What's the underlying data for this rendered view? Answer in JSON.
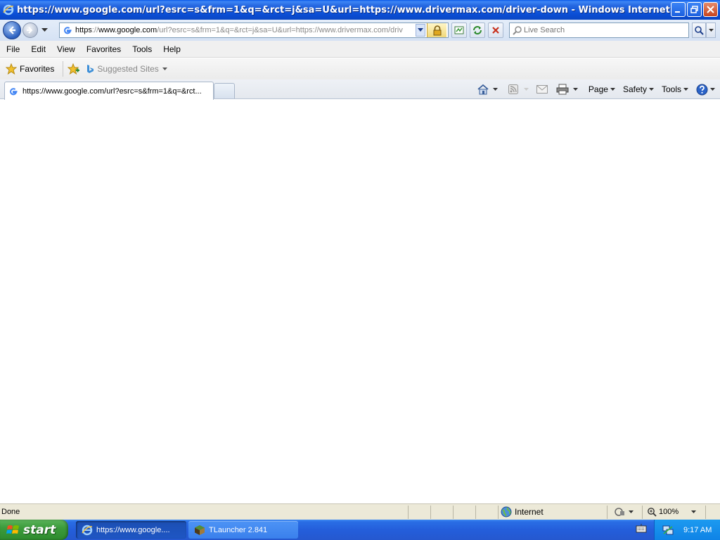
{
  "window": {
    "title": "https://www.google.com/url?esrc=s&frm=1&q=&rct=j&sa=U&url=https://www.drivermax.com/driver-down - Windows Internet Explorer"
  },
  "address": {
    "scheme": "https",
    "rest_prefix": "://",
    "host": "www.google.com",
    "path": "/url?esrc=s&frm=1&q=&rct=j&sa=U&url=https://www.drivermax.com/driv"
  },
  "search": {
    "placeholder": "Live Search"
  },
  "menu": [
    "File",
    "Edit",
    "View",
    "Favorites",
    "Tools",
    "Help"
  ],
  "favorites": {
    "label": "Favorites",
    "suggested": "Suggested Sites"
  },
  "tab": {
    "title": "https://www.google.com/url?esrc=s&frm=1&q=&rct..."
  },
  "commandbar": {
    "page": "Page",
    "safety": "Safety",
    "tools": "Tools"
  },
  "status": {
    "text": "Done",
    "zone": "Internet",
    "zoom": "100%"
  },
  "taskbar": {
    "start": "start",
    "items": [
      {
        "label": "https://www.google...."
      },
      {
        "label": "TLauncher 2.841"
      }
    ],
    "clock": "9:17 AM"
  },
  "colors": {
    "titlebar": "#0b4fd6",
    "taskbar": "#245edb",
    "start": "#3c9b3c",
    "tray": "#0f83e6"
  }
}
